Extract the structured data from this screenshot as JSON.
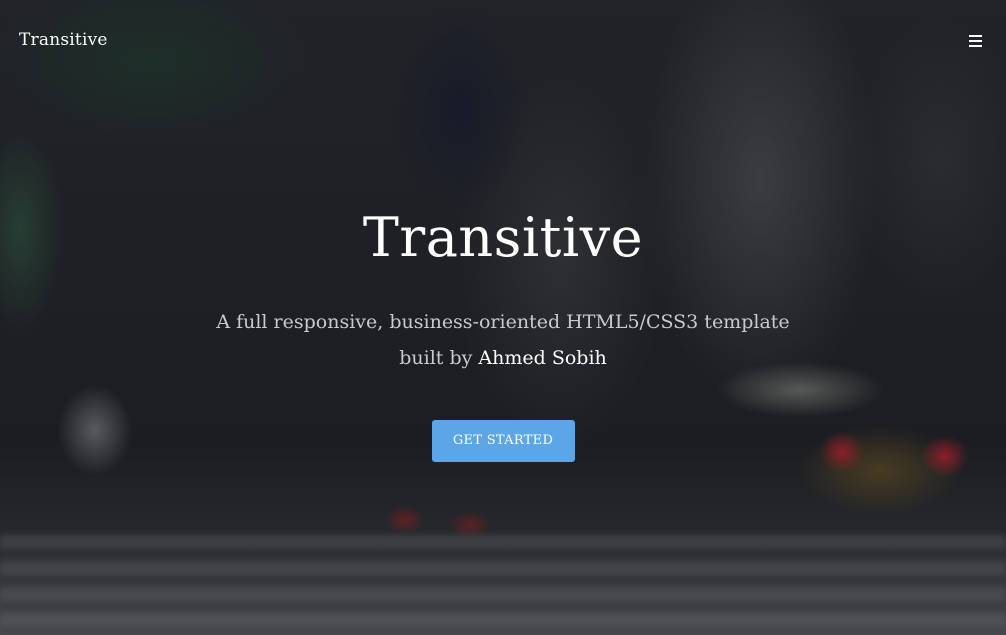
{
  "navbar": {
    "brand": "Transitive",
    "menu_icon": "hamburger-menu-icon"
  },
  "hero": {
    "title": "Transitive",
    "subtitle_line1": "A full responsive, business-oriented HTML5/CSS3 template",
    "subtitle_line2_prefix": "built by ",
    "author": "Ahmed Sobih",
    "cta_label": "GET STARTED"
  },
  "colors": {
    "accent": "#5ca6e8",
    "text": "#ffffff",
    "muted_text": "#c9cacd"
  }
}
